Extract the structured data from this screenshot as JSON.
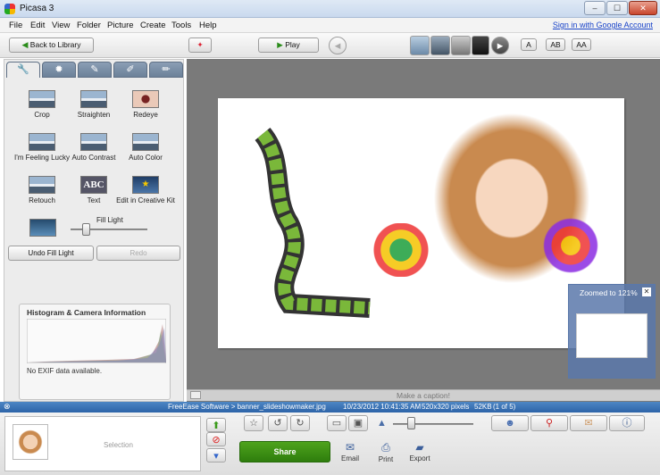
{
  "window": {
    "title": "Picasa 3",
    "minimize": "–",
    "maximize": "☐",
    "close": "✕"
  },
  "menu": {
    "items": [
      "File",
      "Edit",
      "View",
      "Folder",
      "Picture",
      "Create",
      "Tools",
      "Help"
    ],
    "signin": "Sign in with Google Account"
  },
  "toolbar": {
    "back_label": "Back to Library",
    "play_label": "Play",
    "caption_modes": [
      "A",
      "AB",
      "AA"
    ]
  },
  "left_panel": {
    "tabs": [
      "wrench",
      "sun",
      "brush",
      "pencil",
      "brush"
    ],
    "tools": [
      {
        "label": "Crop"
      },
      {
        "label": "Straighten"
      },
      {
        "label": "Redeye"
      },
      {
        "label": "I'm Feeling Lucky"
      },
      {
        "label": "Auto Contrast"
      },
      {
        "label": "Auto Color"
      },
      {
        "label": "Retouch"
      },
      {
        "label": "Text"
      },
      {
        "label": "Edit in Creative Kit"
      }
    ],
    "fill_light_label": "Fill Light",
    "fill_light_level": 0.2,
    "undo_label": "Undo Fill Light",
    "redo_label": "Redo",
    "histogram_title": "Histogram & Camera Information",
    "exif_text": "No EXIF data available."
  },
  "viewer": {
    "zoom_text": "Zoomed to 121%",
    "caption_placeholder": "Make a caption!"
  },
  "status": {
    "path": "FreeEase Software > banner_slideshowmaker.jpg",
    "date": "10/23/2012 10:41:35 AM",
    "dimensions": "520x320 pixels",
    "size": "52KB",
    "position": "(1 of 5)"
  },
  "tray": {
    "selection_label": "Selection",
    "share_label": "Share",
    "actions": [
      "Email",
      "Print",
      "Export"
    ]
  },
  "colors": {
    "accent_blue": "#2d64a8",
    "share_green": "#3a8f14"
  }
}
